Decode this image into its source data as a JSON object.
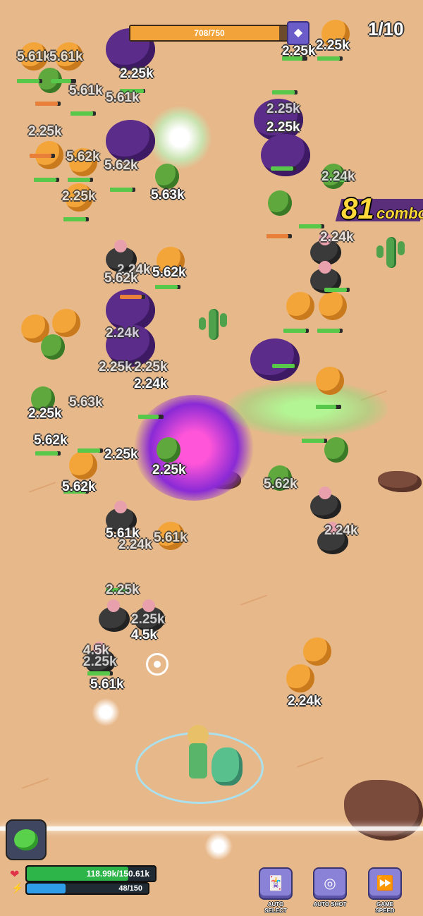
{
  "hud": {
    "boss_hp_text": "708/750",
    "boss_hp_fraction": 0.944,
    "wave_text": "1/10",
    "combo_count": "81",
    "combo_label": "combo"
  },
  "player": {
    "hp_text": "118.99k/150.61k",
    "hp_fraction": 0.79,
    "mp_text": "48/150",
    "mp_fraction": 0.32
  },
  "controls": [
    {
      "label": "AUTO SELECT",
      "icon": "cards-icon"
    },
    {
      "label": "AUTO SHOT",
      "icon": "crosshair-icon"
    },
    {
      "label": "GAME SPEED",
      "icon": "fast-forward-icon"
    }
  ],
  "damage_numbers": [
    "2.25k",
    "2.25k",
    "5.61k",
    "5.61k",
    "2.25k",
    "5.61k",
    "5.61k",
    "5.62k",
    "5.62k",
    "2.25k",
    "2.24k",
    "2.25k",
    "2.25k",
    "5.63k",
    "5.62k",
    "2.24k",
    "5.62k",
    "2.24k",
    "2.24k",
    "2.25k",
    "2.25k",
    "2.24k",
    "2.25k",
    "5.63k",
    "5.62k",
    "2.25k",
    "2.25k",
    "5.62k",
    "5.62k",
    "5.61k",
    "2.24k",
    "5.61k",
    "2.24k",
    "2.25k",
    "2.25k",
    "4.5k",
    "4.5k",
    "2.25k",
    "5.61k",
    "2.24k",
    "2.25k"
  ],
  "colors": {
    "sand": "#e7b88a",
    "hp_green": "#2db54a",
    "mp_blue": "#2f9de8",
    "combo_yellow": "#ffd83a",
    "button_purple": "#8a82d6"
  }
}
